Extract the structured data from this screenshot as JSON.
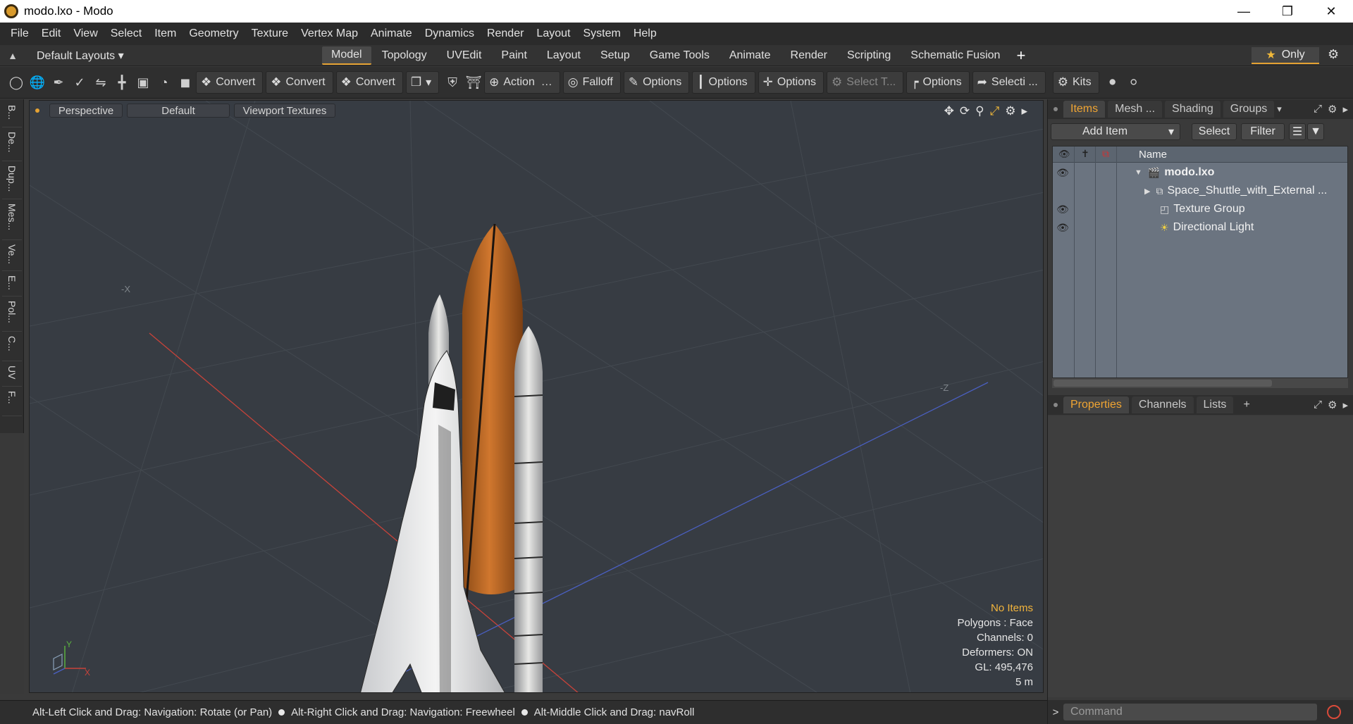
{
  "window": {
    "title": "modo.lxo - Modo",
    "minimize": "—",
    "maximize": "❐",
    "close": "✕"
  },
  "menu": [
    "File",
    "Edit",
    "View",
    "Select",
    "Item",
    "Geometry",
    "Texture",
    "Vertex Map",
    "Animate",
    "Dynamics",
    "Render",
    "Layout",
    "System",
    "Help"
  ],
  "layout_bar": {
    "layouts_label": "Default Layouts ▾",
    "tabs": [
      "Model",
      "Topology",
      "UVEdit",
      "Paint",
      "Layout",
      "Setup",
      "Game Tools",
      "Animate",
      "Render",
      "Scripting",
      "Schematic Fusion"
    ],
    "active_tab": "Model",
    "only_label": "Only"
  },
  "toolbar": {
    "convert1": "Convert",
    "convert2": "Convert",
    "convert3": "Convert",
    "action": "Action",
    "action_more": "…",
    "falloff": "Falloff",
    "options1": "Options",
    "options2": "Options",
    "options3": "Options",
    "select_t": "Select T...",
    "options4": "Options",
    "selecti": "Selecti ...",
    "kits": "Kits"
  },
  "left_tabs": [
    "B...",
    "De...",
    "Dup...",
    "Mes...",
    "Ve...",
    "E...",
    "Pol...",
    "C...",
    "UV",
    "F..."
  ],
  "viewport": {
    "view": "Perspective",
    "style": "Default",
    "textures": "Viewport Textures",
    "axis_labels": {
      "neg_x": "-X",
      "neg_z": "-Z"
    },
    "gizmo": {
      "y": "Y",
      "x": "X"
    },
    "info": {
      "selection": "No Items",
      "polygons": "Polygons : Face",
      "channels": "Channels: 0",
      "deformers": "Deformers: ON",
      "gl": "GL: 495,476",
      "scale": "5 m"
    }
  },
  "status": {
    "hint1": "Alt-Left Click and Drag: Navigation: Rotate (or Pan)",
    "hint2": "Alt-Right Click and Drag: Navigation: Freewheel",
    "hint3": "Alt-Middle Click and Drag: navRoll"
  },
  "items_panel": {
    "tabs": [
      "Items",
      "Mesh ...",
      "Shading",
      "Groups"
    ],
    "active_tab": "Items",
    "add_item": "Add Item",
    "select": "Select",
    "filter": "Filter",
    "column_name": "Name",
    "tree": [
      {
        "label": "modo.lxo",
        "visible": true
      },
      {
        "label": "Space_Shuttle_with_External ...",
        "visible": false
      },
      {
        "label": "Texture Group",
        "visible": true
      },
      {
        "label": "Directional Light",
        "visible": true
      }
    ]
  },
  "props_panel": {
    "tabs": [
      "Properties",
      "Channels",
      "Lists"
    ],
    "active_tab": "Properties",
    "add": "+"
  },
  "command": {
    "placeholder": "Command",
    "caret": ">"
  },
  "colors": {
    "accent": "#e5a233",
    "viewport_bg": "#373c43",
    "x_axis": "#c8433a",
    "z_axis": "#4a5fc0"
  }
}
